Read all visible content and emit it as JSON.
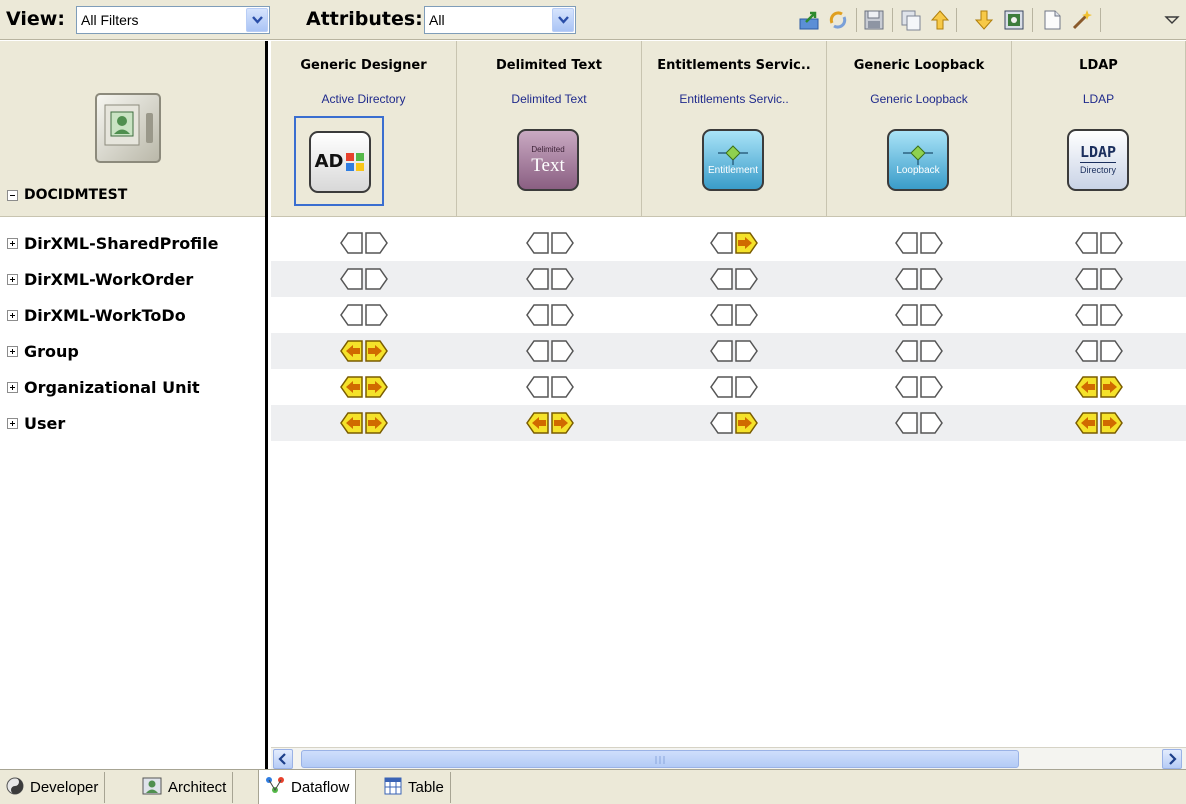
{
  "toolbar": {
    "view_label": "View:",
    "view_value": "All Filters",
    "attributes_label": "Attributes:",
    "attributes_value": "All",
    "icons": [
      "export-icon",
      "refresh-icon",
      "save-icon",
      "copy-icon",
      "move-up-icon",
      "move-down-icon",
      "configure-icon",
      "new-document-icon",
      "wizard-icon",
      "menu-icon"
    ]
  },
  "root": {
    "label": "DOCIDMTEST",
    "icon": "vault-icon"
  },
  "tree": [
    {
      "label": "DirXML-SharedProfile"
    },
    {
      "label": "DirXML-WorkOrder"
    },
    {
      "label": "DirXML-WorkToDo"
    },
    {
      "label": "Group"
    },
    {
      "label": "Organizational Unit"
    },
    {
      "label": "User"
    }
  ],
  "columns": [
    {
      "title": "Generic Designer",
      "subtitle": "Active Directory",
      "icon": "active-directory-icon",
      "icon_text": "AD"
    },
    {
      "title": "Delimited Text",
      "subtitle": "Delimited Text",
      "icon": "delimited-text-icon",
      "icon_text": "Text",
      "icon_small_text": "Delimited"
    },
    {
      "title": "Entitlements Servic..",
      "subtitle": "Entitlements Servic..",
      "icon": "entitlement-icon",
      "icon_text": "Entitlement"
    },
    {
      "title": "Generic Loopback",
      "subtitle": "Generic Loopback",
      "icon": "loopback-icon",
      "icon_text": "Loopback"
    },
    {
      "title": "LDAP",
      "subtitle": "LDAP",
      "icon": "ldap-icon",
      "icon_text": "LDAP",
      "icon_small_text": "Directory"
    }
  ],
  "flow_matrix": [
    [
      "none",
      "none",
      "right",
      "none",
      "none"
    ],
    [
      "none",
      "none",
      "none",
      "none",
      "none"
    ],
    [
      "none",
      "none",
      "none",
      "none",
      "none"
    ],
    [
      "both",
      "none",
      "none",
      "none",
      "none"
    ],
    [
      "both",
      "none",
      "none",
      "none",
      "both"
    ],
    [
      "both",
      "both",
      "right",
      "none",
      "both"
    ]
  ],
  "flow_legend": {
    "none": "no-flow-icon",
    "right": "subscriber-flow-icon",
    "both": "bidirectional-flow-icon"
  },
  "tabs": [
    {
      "label": "Developer",
      "icon": "developer-icon",
      "active": false
    },
    {
      "label": "Architect",
      "icon": "architect-icon",
      "active": false
    },
    {
      "label": "Dataflow",
      "icon": "dataflow-icon",
      "active": true
    },
    {
      "label": "Table",
      "icon": "table-icon",
      "active": false
    }
  ]
}
